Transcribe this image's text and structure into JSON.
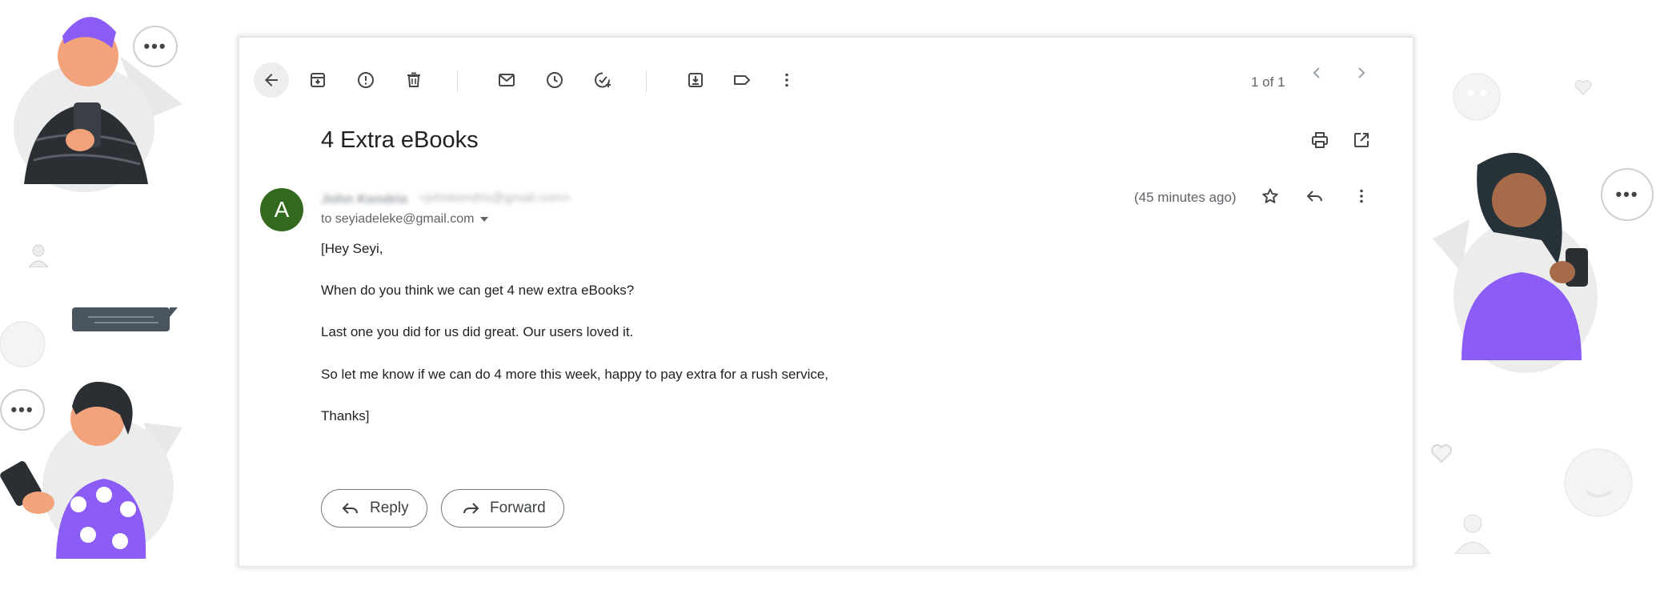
{
  "toolbar": {
    "back_icon": "arrow-left-icon",
    "icons": [
      "archive-icon",
      "report-spam-icon",
      "delete-icon",
      "mark-unread-icon",
      "snooze-icon",
      "add-to-tasks-icon",
      "move-to-icon",
      "label-icon",
      "more-vert-icon"
    ],
    "pager_text": "1 of 1"
  },
  "email": {
    "subject": "4 Extra eBooks",
    "avatar_letter": "A",
    "avatar_color": "#33691e",
    "sender_name": "John Kendrix",
    "sender_email": "<johnkendrix@gmail.com>",
    "to_line": "to seyiadeleke@gmail.com",
    "time": "(45 minutes ago)",
    "body": [
      "[Hey Seyi,",
      "When do you think we can get 4 new extra eBooks?",
      "Last one you did for us did great. Our users loved it.",
      "So let me know if we can do 4 more this week, happy to pay extra for a rush service,",
      "Thanks]"
    ]
  },
  "actions": {
    "reply_label": "Reply",
    "forward_label": "Forward"
  },
  "decor": {
    "bubble_text": "•••"
  }
}
